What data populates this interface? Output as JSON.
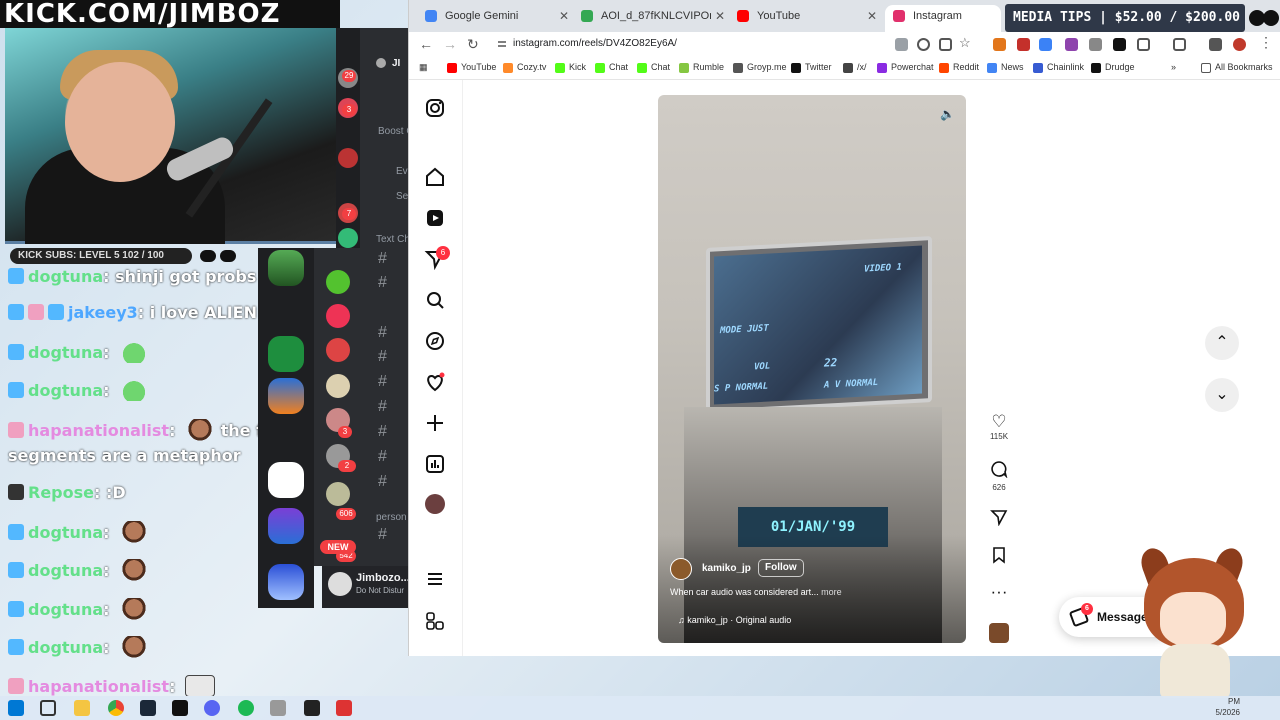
{
  "stream": {
    "banner": "KICK.COM/JIMBOZ",
    "subs_bar": "KICK SUBS: LEVEL 5 102 / 100",
    "media_tips": "MEDIA TIPS | $52.00 / $200.00"
  },
  "chat": [
    {
      "user": "dogtuna",
      "text": "shinji got probs",
      "color": "green"
    },
    {
      "user": "jakeey3",
      "text": "i love ALIEN CAT!",
      "color": "blue"
    },
    {
      "user": "dogtuna",
      "text": "",
      "color": "green"
    },
    {
      "user": "dogtuna",
      "text": "",
      "color": "green"
    },
    {
      "user": "hapanationalist",
      "text": "the fighting",
      "color": "pink"
    },
    {
      "user": "",
      "text": "segments are a metaphor",
      "color": "white"
    },
    {
      "user": "Repose",
      "text": ":D",
      "color": "green"
    },
    {
      "user": "dogtuna",
      "text": "",
      "color": "green"
    },
    {
      "user": "dogtuna",
      "text": "",
      "color": "green"
    },
    {
      "user": "dogtuna",
      "text": "",
      "color": "green"
    },
    {
      "user": "dogtuna",
      "text": "",
      "color": "green"
    },
    {
      "user": "hapanationalist",
      "text": "",
      "color": "pink"
    }
  ],
  "discord": {
    "username": "Jimbozo...",
    "status": "Do Not Distur",
    "new_pill": "NEW",
    "boost_label": "Boost G",
    "events_label": "Ev",
    "server_label": "Se",
    "text_channels_label": "Text Ch",
    "person_label": "person",
    "header_label": "JI",
    "badges": [
      "29",
      "3",
      "7",
      "3",
      "1",
      "2",
      "1K+",
      "606",
      "542"
    ]
  },
  "browser": {
    "tabs": [
      {
        "label": "Google Gemini",
        "color": "#4285f4",
        "active": false
      },
      {
        "label": "AOI_d_87fKNLCVIPOmVMryISdb",
        "color": "#34a853",
        "active": false
      },
      {
        "label": "YouTube",
        "color": "#ff0000",
        "active": false
      },
      {
        "label": "Instagram",
        "color": "#e1306c",
        "active": true
      }
    ],
    "url": "instagram.com/reels/DV4ZO82Ey6A/",
    "bookmarks": [
      {
        "label": "YouTube",
        "color": "#ff0000"
      },
      {
        "label": "Cozy.tv",
        "color": "#ff8a2a"
      },
      {
        "label": "Kick",
        "color": "#53fc18"
      },
      {
        "label": "Chat",
        "color": "#53fc18"
      },
      {
        "label": "Chat",
        "color": "#53fc18"
      },
      {
        "label": "Rumble",
        "color": "#85c742"
      },
      {
        "label": "Groyp.me",
        "color": "#555555"
      },
      {
        "label": "Twitter",
        "color": "#111111"
      },
      {
        "label": "/x/",
        "color": "#444444"
      },
      {
        "label": "Powerchat",
        "color": "#8a2be2"
      },
      {
        "label": "Reddit",
        "color": "#ff4500"
      },
      {
        "label": "News",
        "color": "#4285f4"
      },
      {
        "label": "Chainlink",
        "color": "#375bd2"
      },
      {
        "label": "Drudge",
        "color": "#111111"
      }
    ],
    "all_bookmarks": "All Bookmarks"
  },
  "instagram": {
    "notifications_badge": "6",
    "reel": {
      "username": "kamiko_jp",
      "follow_label": "Follow",
      "caption": "When car audio was considered art...",
      "more_label": "more",
      "audio": "kamiko_jp · Original audio",
      "osd_video": "VIDEO 1",
      "osd_mode": "MODE JUST",
      "osd_vol": "VOL",
      "osd_vol_value": "22",
      "osd_sp": "S P NORMAL",
      "osd_av": "A V NORMAL",
      "display_text": "01/JAN/'99"
    },
    "actions": {
      "likes": "115K",
      "comments": "626"
    },
    "messages_label": "Messages",
    "messages_badge": "6"
  },
  "taskbar": {
    "time": "PM",
    "date": "5/2026"
  }
}
